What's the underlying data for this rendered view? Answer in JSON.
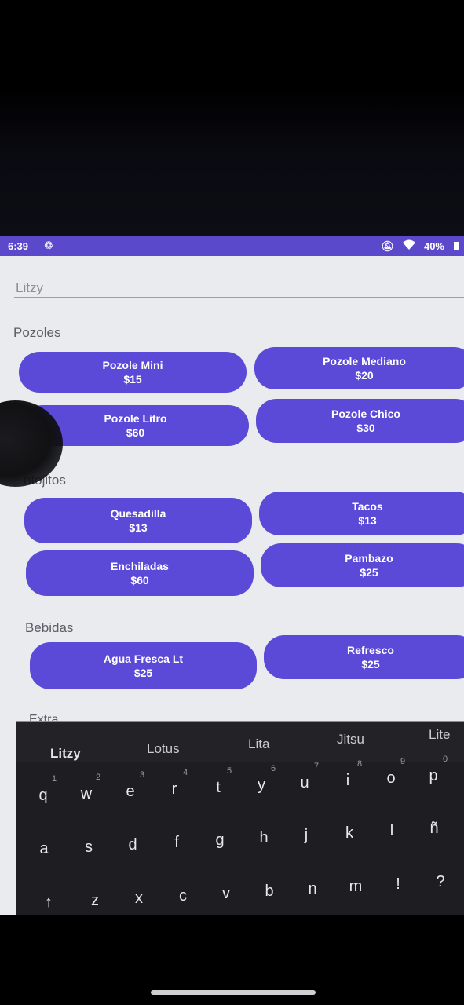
{
  "status_bar": {
    "time": "6:39",
    "battery": "40%"
  },
  "name_field": {
    "value": "Litzy"
  },
  "sections": {
    "pozoles": "Pozoles",
    "antojitos": "ntojitos",
    "bebidas": "Bebidas",
    "extra": "Extra"
  },
  "items": {
    "pozole_mini": {
      "name": "Pozole Mini",
      "price": "$15"
    },
    "pozole_mediano": {
      "name": "Pozole Mediano",
      "price": "$20"
    },
    "pozole_litro": {
      "name": "Pozole Litro",
      "price": "$60"
    },
    "pozole_chico": {
      "name": "Pozole Chico",
      "price": "$30"
    },
    "quesadilla": {
      "name": "Quesadilla",
      "price": "$13"
    },
    "tacos": {
      "name": "Tacos",
      "price": "$13"
    },
    "enchiladas": {
      "name": "Enchiladas",
      "price": "$60"
    },
    "pambazo": {
      "name": "Pambazo",
      "price": "$25"
    },
    "agua_fresca": {
      "name": "Agua Fresca Lt",
      "price": "$25"
    },
    "refresco": {
      "name": "Refresco",
      "price": "$25"
    }
  },
  "keyboard": {
    "suggestions": [
      "Litzy",
      "Lotus",
      "Lita",
      "Jitsu",
      "Lite"
    ],
    "row1": [
      "q",
      "w",
      "e",
      "r",
      "t",
      "y",
      "u",
      "i",
      "o",
      "p"
    ],
    "row1_hints": [
      "1",
      "2",
      "3",
      "4",
      "5",
      "6",
      "7",
      "8",
      "9",
      "0"
    ],
    "row2": [
      "a",
      "s",
      "d",
      "f",
      "g",
      "h",
      "j",
      "k",
      "l",
      "ñ"
    ],
    "row3": [
      "↑",
      "z",
      "x",
      "c",
      "v",
      "b",
      "n",
      "m",
      "!",
      "?"
    ]
  },
  "colors": {
    "accent": "#5b49d8",
    "status_bar": "#5b49cc",
    "background": "#e9ebef"
  }
}
